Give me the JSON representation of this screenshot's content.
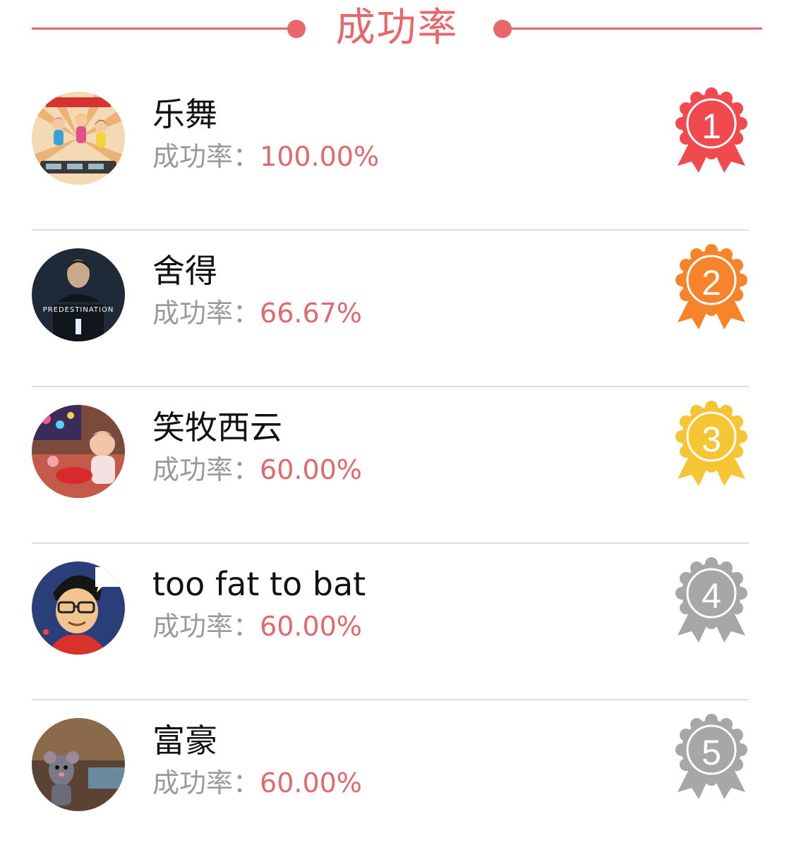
{
  "header": {
    "title": "成功率"
  },
  "colors": {
    "accent": "#e8676b",
    "rate_value": "#e0696c",
    "label_gray": "#9a9a9a",
    "medal_gold_red": "#f04a4f",
    "medal_orange": "#f7842a",
    "medal_yellow": "#f6c533",
    "medal_gray": "#a7a7a7"
  },
  "ranking": [
    {
      "rank": "1",
      "name": "乐舞",
      "rate_label": "成功率：",
      "rate_value": "100.00%",
      "medal_color": "#f04a4f",
      "avatar": "dance-cartoon-avatar"
    },
    {
      "rank": "2",
      "name": "舍得",
      "rate_label": "成功率：",
      "rate_value": "66.67%",
      "medal_color": "#f7842a",
      "avatar": "movie-poster-avatar",
      "avatar_text": "PREDESTINATION"
    },
    {
      "rank": "3",
      "name": "笑牧西云",
      "rate_label": "成功率：",
      "rate_value": "60.00%",
      "medal_color": "#f6c533",
      "avatar": "child-photo-avatar"
    },
    {
      "rank": "4",
      "name": "too fat to bat",
      "rate_label": "成功率：",
      "rate_value": "60.00%",
      "medal_color": "#a7a7a7",
      "avatar": "cartoon-glasses-avatar"
    },
    {
      "rank": "5",
      "name": "富豪",
      "rate_label": "成功率：",
      "rate_value": "60.00%",
      "medal_color": "#a7a7a7",
      "avatar": "rat-movie-avatar"
    }
  ]
}
